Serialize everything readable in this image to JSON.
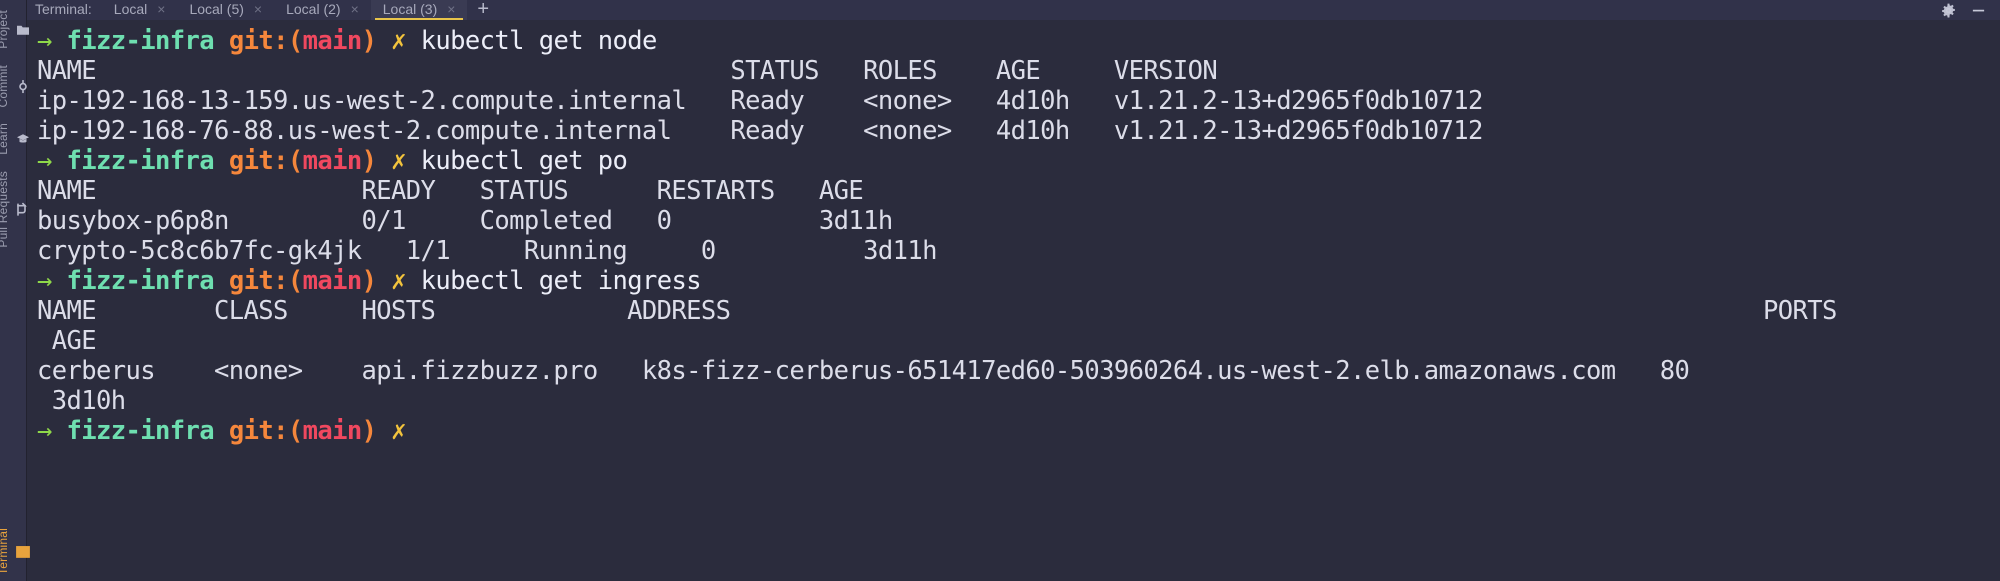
{
  "window": {
    "background": "#2b2c3d",
    "accent": "#e8c44a"
  },
  "tool_strip": {
    "items": [
      {
        "label": "Project",
        "icon": "folder-icon",
        "active": false
      },
      {
        "label": "Commit",
        "icon": "commit-icon",
        "active": false
      },
      {
        "label": "Learn",
        "icon": "graduation-cap-icon",
        "active": false
      },
      {
        "label": "Pull Requests",
        "icon": "pull-request-icon",
        "active": false
      }
    ],
    "bottom_items": [
      {
        "label": "Terminal",
        "icon": "terminal-icon",
        "active": true
      }
    ]
  },
  "tab_bar": {
    "title": "Terminal:",
    "tabs": [
      {
        "label": "Local",
        "close": "×",
        "active": false
      },
      {
        "label": "Local (5)",
        "close": "×",
        "active": false
      },
      {
        "label": "Local (2)",
        "close": "×",
        "active": false
      },
      {
        "label": "Local (3)",
        "close": "×",
        "active": true
      }
    ],
    "add_label": "+",
    "actions": [
      {
        "name": "settings-gear-icon",
        "label": "Settings"
      },
      {
        "name": "minimize-icon",
        "label": "Minimize"
      }
    ]
  },
  "terminal": {
    "prompt": {
      "arrow": "→",
      "dir": "fizz-infra",
      "git_open": "git:(",
      "branch": "main",
      "git_close": ")",
      "status": "✗"
    },
    "lines": [
      {
        "type": "prompt",
        "command": "kubectl get node"
      },
      {
        "type": "output",
        "text": "NAME                                           STATUS   ROLES    AGE     VERSION"
      },
      {
        "type": "output",
        "text": "ip-192-168-13-159.us-west-2.compute.internal   Ready    <none>   4d10h   v1.21.2-13+d2965f0db10712"
      },
      {
        "type": "output",
        "text": "ip-192-168-76-88.us-west-2.compute.internal    Ready    <none>   4d10h   v1.21.2-13+d2965f0db10712"
      },
      {
        "type": "prompt",
        "command": "kubectl get po"
      },
      {
        "type": "output",
        "text": "NAME                  READY   STATUS      RESTARTS   AGE"
      },
      {
        "type": "output",
        "text": "busybox-p6p8n         0/1     Completed   0          3d11h"
      },
      {
        "type": "output",
        "text": "crypto-5c8c6b7fc-gk4jk   1/1     Running     0          3d11h"
      },
      {
        "type": "prompt",
        "command": "kubectl get ingress"
      },
      {
        "type": "output",
        "text": "NAME        CLASS     HOSTS             ADDRESS                                                                      PORTS"
      },
      {
        "type": "output",
        "text": " AGE"
      },
      {
        "type": "output",
        "text": "cerberus    <none>    api.fizzbuzz.pro   k8s-fizz-cerberus-651417ed60-503960264.us-west-2.elb.amazonaws.com   80"
      },
      {
        "type": "output",
        "text": " 3d10h"
      },
      {
        "type": "prompt",
        "command": ""
      }
    ]
  }
}
